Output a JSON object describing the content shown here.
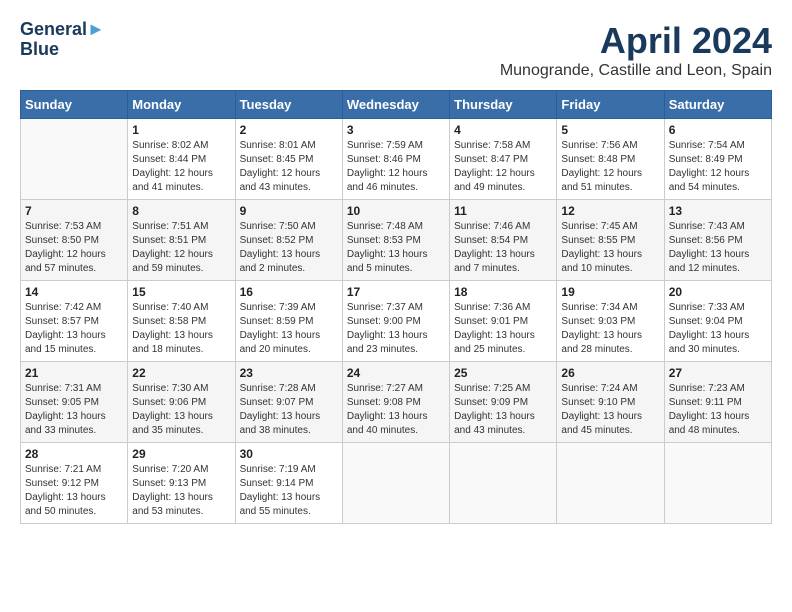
{
  "logo": {
    "line1": "General",
    "line2": "Blue"
  },
  "title": "April 2024",
  "location": "Munogrande, Castille and Leon, Spain",
  "days_of_week": [
    "Sunday",
    "Monday",
    "Tuesday",
    "Wednesday",
    "Thursday",
    "Friday",
    "Saturday"
  ],
  "weeks": [
    [
      {
        "day": "",
        "sunrise": "",
        "sunset": "",
        "daylight": ""
      },
      {
        "day": "1",
        "sunrise": "Sunrise: 8:02 AM",
        "sunset": "Sunset: 8:44 PM",
        "daylight": "Daylight: 12 hours and 41 minutes."
      },
      {
        "day": "2",
        "sunrise": "Sunrise: 8:01 AM",
        "sunset": "Sunset: 8:45 PM",
        "daylight": "Daylight: 12 hours and 43 minutes."
      },
      {
        "day": "3",
        "sunrise": "Sunrise: 7:59 AM",
        "sunset": "Sunset: 8:46 PM",
        "daylight": "Daylight: 12 hours and 46 minutes."
      },
      {
        "day": "4",
        "sunrise": "Sunrise: 7:58 AM",
        "sunset": "Sunset: 8:47 PM",
        "daylight": "Daylight: 12 hours and 49 minutes."
      },
      {
        "day": "5",
        "sunrise": "Sunrise: 7:56 AM",
        "sunset": "Sunset: 8:48 PM",
        "daylight": "Daylight: 12 hours and 51 minutes."
      },
      {
        "day": "6",
        "sunrise": "Sunrise: 7:54 AM",
        "sunset": "Sunset: 8:49 PM",
        "daylight": "Daylight: 12 hours and 54 minutes."
      }
    ],
    [
      {
        "day": "7",
        "sunrise": "Sunrise: 7:53 AM",
        "sunset": "Sunset: 8:50 PM",
        "daylight": "Daylight: 12 hours and 57 minutes."
      },
      {
        "day": "8",
        "sunrise": "Sunrise: 7:51 AM",
        "sunset": "Sunset: 8:51 PM",
        "daylight": "Daylight: 12 hours and 59 minutes."
      },
      {
        "day": "9",
        "sunrise": "Sunrise: 7:50 AM",
        "sunset": "Sunset: 8:52 PM",
        "daylight": "Daylight: 13 hours and 2 minutes."
      },
      {
        "day": "10",
        "sunrise": "Sunrise: 7:48 AM",
        "sunset": "Sunset: 8:53 PM",
        "daylight": "Daylight: 13 hours and 5 minutes."
      },
      {
        "day": "11",
        "sunrise": "Sunrise: 7:46 AM",
        "sunset": "Sunset: 8:54 PM",
        "daylight": "Daylight: 13 hours and 7 minutes."
      },
      {
        "day": "12",
        "sunrise": "Sunrise: 7:45 AM",
        "sunset": "Sunset: 8:55 PM",
        "daylight": "Daylight: 13 hours and 10 minutes."
      },
      {
        "day": "13",
        "sunrise": "Sunrise: 7:43 AM",
        "sunset": "Sunset: 8:56 PM",
        "daylight": "Daylight: 13 hours and 12 minutes."
      }
    ],
    [
      {
        "day": "14",
        "sunrise": "Sunrise: 7:42 AM",
        "sunset": "Sunset: 8:57 PM",
        "daylight": "Daylight: 13 hours and 15 minutes."
      },
      {
        "day": "15",
        "sunrise": "Sunrise: 7:40 AM",
        "sunset": "Sunset: 8:58 PM",
        "daylight": "Daylight: 13 hours and 18 minutes."
      },
      {
        "day": "16",
        "sunrise": "Sunrise: 7:39 AM",
        "sunset": "Sunset: 8:59 PM",
        "daylight": "Daylight: 13 hours and 20 minutes."
      },
      {
        "day": "17",
        "sunrise": "Sunrise: 7:37 AM",
        "sunset": "Sunset: 9:00 PM",
        "daylight": "Daylight: 13 hours and 23 minutes."
      },
      {
        "day": "18",
        "sunrise": "Sunrise: 7:36 AM",
        "sunset": "Sunset: 9:01 PM",
        "daylight": "Daylight: 13 hours and 25 minutes."
      },
      {
        "day": "19",
        "sunrise": "Sunrise: 7:34 AM",
        "sunset": "Sunset: 9:03 PM",
        "daylight": "Daylight: 13 hours and 28 minutes."
      },
      {
        "day": "20",
        "sunrise": "Sunrise: 7:33 AM",
        "sunset": "Sunset: 9:04 PM",
        "daylight": "Daylight: 13 hours and 30 minutes."
      }
    ],
    [
      {
        "day": "21",
        "sunrise": "Sunrise: 7:31 AM",
        "sunset": "Sunset: 9:05 PM",
        "daylight": "Daylight: 13 hours and 33 minutes."
      },
      {
        "day": "22",
        "sunrise": "Sunrise: 7:30 AM",
        "sunset": "Sunset: 9:06 PM",
        "daylight": "Daylight: 13 hours and 35 minutes."
      },
      {
        "day": "23",
        "sunrise": "Sunrise: 7:28 AM",
        "sunset": "Sunset: 9:07 PM",
        "daylight": "Daylight: 13 hours and 38 minutes."
      },
      {
        "day": "24",
        "sunrise": "Sunrise: 7:27 AM",
        "sunset": "Sunset: 9:08 PM",
        "daylight": "Daylight: 13 hours and 40 minutes."
      },
      {
        "day": "25",
        "sunrise": "Sunrise: 7:25 AM",
        "sunset": "Sunset: 9:09 PM",
        "daylight": "Daylight: 13 hours and 43 minutes."
      },
      {
        "day": "26",
        "sunrise": "Sunrise: 7:24 AM",
        "sunset": "Sunset: 9:10 PM",
        "daylight": "Daylight: 13 hours and 45 minutes."
      },
      {
        "day": "27",
        "sunrise": "Sunrise: 7:23 AM",
        "sunset": "Sunset: 9:11 PM",
        "daylight": "Daylight: 13 hours and 48 minutes."
      }
    ],
    [
      {
        "day": "28",
        "sunrise": "Sunrise: 7:21 AM",
        "sunset": "Sunset: 9:12 PM",
        "daylight": "Daylight: 13 hours and 50 minutes."
      },
      {
        "day": "29",
        "sunrise": "Sunrise: 7:20 AM",
        "sunset": "Sunset: 9:13 PM",
        "daylight": "Daylight: 13 hours and 53 minutes."
      },
      {
        "day": "30",
        "sunrise": "Sunrise: 7:19 AM",
        "sunset": "Sunset: 9:14 PM",
        "daylight": "Daylight: 13 hours and 55 minutes."
      },
      {
        "day": "",
        "sunrise": "",
        "sunset": "",
        "daylight": ""
      },
      {
        "day": "",
        "sunrise": "",
        "sunset": "",
        "daylight": ""
      },
      {
        "day": "",
        "sunrise": "",
        "sunset": "",
        "daylight": ""
      },
      {
        "day": "",
        "sunrise": "",
        "sunset": "",
        "daylight": ""
      }
    ]
  ]
}
